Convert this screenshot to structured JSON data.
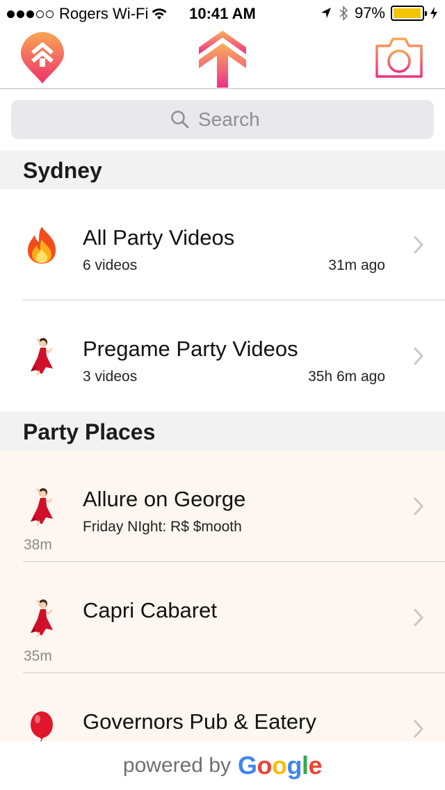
{
  "status_bar": {
    "carrier": "Rogers Wi-Fi",
    "time": "10:41 AM",
    "battery": "97%",
    "battery_level": 0.97
  },
  "nav": {
    "left_icon": "location-pin-arrows-icon",
    "center_icon": "upvote-arrows-logo-icon",
    "right_icon": "camera-icon"
  },
  "search": {
    "placeholder": "Search"
  },
  "sections": {
    "city": "Sydney",
    "places": "Party Places"
  },
  "city_rows": [
    {
      "emoji": "fire",
      "title": "All Party Videos",
      "subtitle": "6 videos",
      "time": "31m ago"
    },
    {
      "emoji": "dancer",
      "title": "Pregame Party Videos",
      "subtitle": "3 videos",
      "time": "35h 6m ago"
    }
  ],
  "place_rows": [
    {
      "emoji": "dancer",
      "title": "Allure on George",
      "subtitle": "Friday NIght: R$ $mooth",
      "distance": "38m"
    },
    {
      "emoji": "dancer",
      "title": "Capri Cabaret",
      "subtitle": "",
      "distance": "35m"
    },
    {
      "emoji": "balloon",
      "title": "Governors Pub & Eatery",
      "subtitle": "",
      "distance": ""
    }
  ],
  "footer": {
    "powered_by": "powered by",
    "google_letters": [
      "G",
      "o",
      "o",
      "g",
      "l",
      "e"
    ],
    "google_colors": [
      "#4285F4",
      "#EA4335",
      "#FBBC05",
      "#4285F4",
      "#34A853",
      "#EA4335"
    ]
  },
  "colors": {
    "accent_gradient_top": "#f7b15a",
    "accent_gradient_bottom": "#f0308a",
    "place_row_bg": "#fef6f0"
  }
}
